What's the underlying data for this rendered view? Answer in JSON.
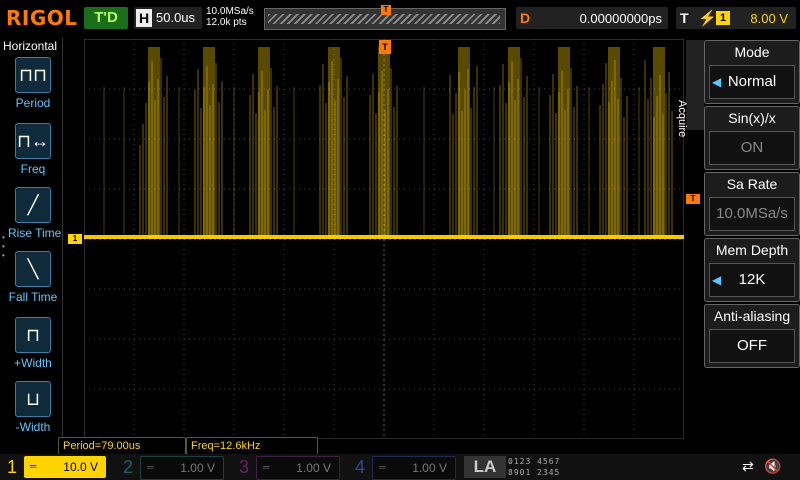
{
  "brand": "RIGOL",
  "topbar": {
    "trigger_status": "T'D",
    "timebase_key": "H",
    "timebase": "50.0us",
    "sample_rate": "10.0MSa/s",
    "mem_points": "12.0k pts",
    "delay_key": "D",
    "delay": "0.00000000ps",
    "trigger_key": "T",
    "trigger_edge": "rising-edge-icon",
    "trigger_source": "1",
    "trigger_level": "8.00 V"
  },
  "left_panel": {
    "title": "Horizontal",
    "items": [
      {
        "label": "Period",
        "icon": "period-icon"
      },
      {
        "label": "Freq",
        "icon": "freq-icon"
      },
      {
        "label": "Rise Time",
        "icon": "rise-time-icon"
      },
      {
        "label": "Fall Time",
        "icon": "fall-time-icon"
      },
      {
        "label": "+Width",
        "icon": "positive-width-icon"
      },
      {
        "label": "-Width",
        "icon": "negative-width-icon"
      }
    ]
  },
  "right_menu": {
    "tab": "Acquire",
    "items": [
      {
        "title": "Mode",
        "value": "Normal"
      },
      {
        "title": "Sin(x)/x",
        "value": "ON"
      },
      {
        "title": "Sa Rate",
        "value": "10.0MSa/s"
      },
      {
        "title": "Mem Depth",
        "value": "12K"
      },
      {
        "title": "Anti-aliasing",
        "value": "OFF"
      }
    ]
  },
  "measurements": {
    "period": "Period=79.00us",
    "freq": "Freq=12.6kHz"
  },
  "channels": [
    {
      "num": "1",
      "scale": "10.0 V",
      "color": "#ffd400",
      "active": true
    },
    {
      "num": "2",
      "scale": "1.00 V",
      "color": "#00c0c0",
      "active": false
    },
    {
      "num": "3",
      "scale": "1.00 V",
      "color": "#e000e0",
      "active": false
    },
    {
      "num": "4",
      "scale": "1.00 V",
      "color": "#3a7fff",
      "active": false
    }
  ],
  "la": {
    "label": "LA",
    "row1": "0123 4567",
    "row2": "8901 2345"
  },
  "colors": {
    "brand": "#ff7a00",
    "ch1": "#ffd400",
    "trigger_marker": "#ff7a00",
    "menu_accent": "#5ac8ff"
  }
}
